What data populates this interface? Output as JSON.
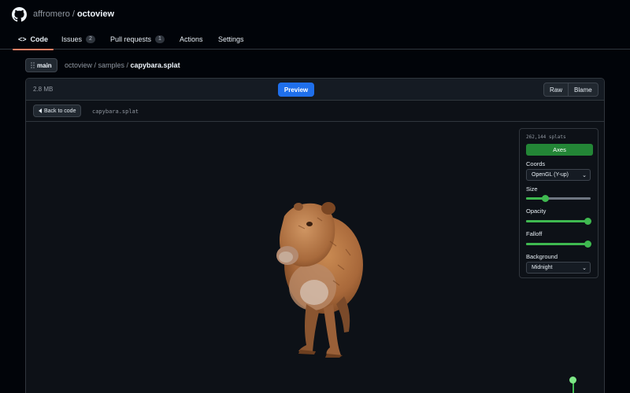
{
  "repo": {
    "owner": "affromero",
    "separator": "/",
    "name": "octoview"
  },
  "tabs": [
    {
      "label": "Code",
      "icon": "code-icon",
      "active": true
    },
    {
      "label": "Issues",
      "count": "2"
    },
    {
      "label": "Pull requests",
      "count": "1"
    },
    {
      "label": "Actions"
    },
    {
      "label": "Settings"
    }
  ],
  "branch": {
    "label": "main",
    "icon": "branch-icon"
  },
  "breadcrumb": {
    "path": "octoview / samples / ",
    "file": "capybara.splat"
  },
  "file_header": {
    "size": "2.8 MB",
    "preview_label": "Preview",
    "raw_label": "Raw",
    "blame_label": "Blame"
  },
  "sub_header": {
    "back_label": "Back to code",
    "filename": "capybara.splat"
  },
  "panel": {
    "splat_count": "262,144 splats",
    "axes_label": "Axes",
    "coords_label": "Coords",
    "coords_value": "OpenGL (Y-up)",
    "size_label": "Size",
    "size_value": 0.27,
    "opacity_label": "Opacity",
    "opacity_value": 1.0,
    "falloff_label": "Falloff",
    "falloff_value": 1.0,
    "background_label": "Background",
    "background_value": "Midnight"
  },
  "colors": {
    "accent_green": "#3fb950",
    "button_blue": "#1f6feb",
    "tab_underline": "#f78166"
  }
}
